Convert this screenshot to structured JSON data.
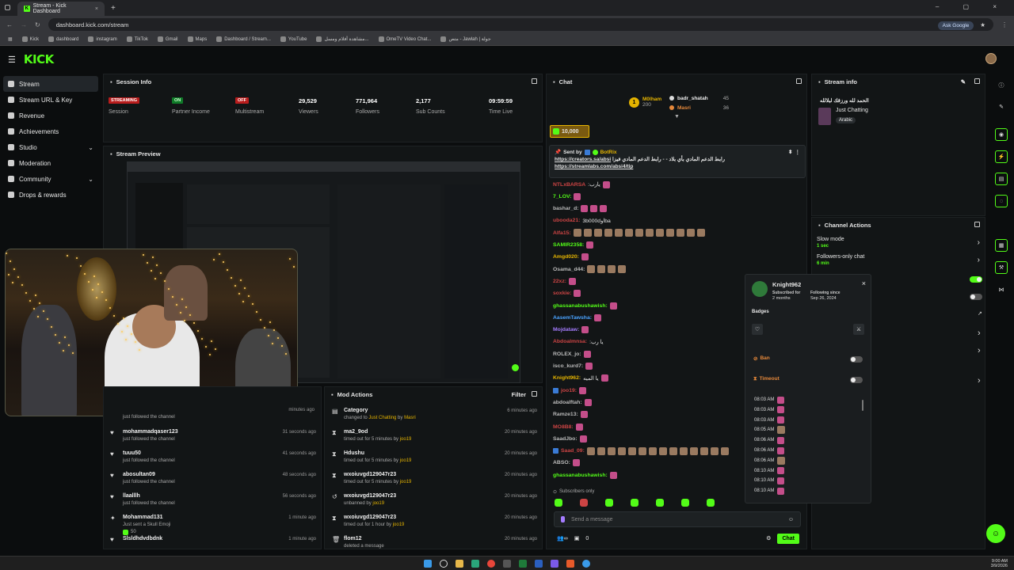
{
  "browser": {
    "tab_title": "Stream - Kick Dashboard",
    "url": "dashboard.kick.com/stream",
    "ask_google": "Ask Google",
    "bookmarks": [
      "Kick",
      "dashboard",
      "instagram",
      "TikTok",
      "Gmail",
      "Maps",
      "Dashboard / Stream...",
      "YouTube",
      "مشاهدة أفلام ومسل...",
      "OmeTV Video Chat...",
      "متص - Jawlah | جولة"
    ]
  },
  "brand": {
    "logo": "KICK",
    "accent": "#53fc18"
  },
  "sidebar": {
    "items": [
      {
        "label": "Stream",
        "icon": "stream-icon",
        "active": true
      },
      {
        "label": "Stream URL & Key",
        "icon": "key-icon"
      },
      {
        "label": "Revenue",
        "icon": "coin-icon"
      },
      {
        "label": "Achievements",
        "icon": "trophy-icon"
      },
      {
        "label": "Studio",
        "icon": "studio-icon",
        "expandable": true
      },
      {
        "label": "Moderation",
        "icon": "sword-icon"
      },
      {
        "label": "Community",
        "icon": "community-icon",
        "expandable": true
      },
      {
        "label": "Drops & rewards",
        "icon": "gift-icon"
      }
    ]
  },
  "session": {
    "title": "Session Info",
    "stats": [
      {
        "value": "STREAMING",
        "label": "Session",
        "kind": "badge-red"
      },
      {
        "value": "ON",
        "label": "Partner Income",
        "kind": "badge-green"
      },
      {
        "value": "OFF",
        "label": "Multistream",
        "kind": "badge-red"
      },
      {
        "value": "29,529",
        "label": "Viewers"
      },
      {
        "value": "771,964",
        "label": "Followers"
      },
      {
        "value": "2,177",
        "label": "Sub Counts"
      },
      {
        "value": "09:59:59",
        "label": "Time Live"
      }
    ]
  },
  "preview": {
    "title": "Stream Preview"
  },
  "followers": {
    "just_followed_text": "just followed the channel",
    "rows": [
      {
        "name": "mohammadqaser123",
        "sub": "just followed the channel",
        "time": "31 seconds ago"
      },
      {
        "name": "tuuu50",
        "sub": "just followed the channel",
        "time": "41 seconds ago"
      },
      {
        "name": "abosultan09",
        "sub": "just followed the channel",
        "time": "48 seconds ago"
      },
      {
        "name": "llaalllh",
        "sub": "just followed the channel",
        "time": "56 seconds ago"
      },
      {
        "name": "Mohammad131",
        "sub": "Just sent a Skull Emoji",
        "amount": "50",
        "time": "1 minute ago"
      },
      {
        "name": "Slsldhdvdbdnk",
        "sub": "",
        "time": "1 minute ago"
      }
    ],
    "top_time": "minutes ago"
  },
  "mod_actions": {
    "title": "Mod Actions",
    "filter": "Filter",
    "rows": [
      {
        "icon": "category-icon",
        "name": "Category",
        "sub_pre": "changed to ",
        "sub_hl": "Just Chatting",
        "sub_mid": " by ",
        "sub_by": "Masri",
        "time": "6 minutes ago"
      },
      {
        "icon": "hourglass-icon",
        "name": "ma2_9od",
        "sub_pre": "timed out for 5 minutes by ",
        "sub_by": "joo19",
        "time": "20 minutes ago"
      },
      {
        "icon": "hourglass-icon",
        "name": "Hdushu",
        "sub_pre": "timed out for 5 minutes by ",
        "sub_by": "joo19",
        "time": "20 minutes ago"
      },
      {
        "icon": "hourglass-icon",
        "name": "wxoiuvgd129047r23",
        "sub_pre": "timed out for 5 minutes by ",
        "sub_by": "joo19",
        "time": "20 minutes ago"
      },
      {
        "icon": "unban-icon",
        "name": "wxoiuvgd129047r23",
        "sub_pre": "unbanned by ",
        "sub_by": "joo19",
        "time": "20 minutes ago"
      },
      {
        "icon": "hourglass-icon",
        "name": "wxoiuvgd129047r23",
        "sub_pre": "timed out for 1 hour by ",
        "sub_by": "joo19",
        "time": "20 minutes ago"
      },
      {
        "icon": "trash-icon",
        "name": "flom12",
        "sub_pre": "deleted a message",
        "sub_by": "",
        "time": "20 minutes ago"
      }
    ]
  },
  "chat": {
    "title": "Chat",
    "top_gifter": {
      "rank": "1",
      "name": "M0lham",
      "count": "200"
    },
    "gifters": [
      {
        "name": "badr_shatah",
        "count": "45"
      },
      {
        "name": "Masri",
        "count": "36"
      }
    ],
    "kicks_amount": "10,000",
    "pinned": {
      "sent_by_label": "Sent by",
      "sender": "BotRix",
      "text_rtl": "رابط الدعم المادي بأي بلاد -",
      "link1": "https://creators.sa/absi",
      "text2": "- رابط الدعم المادي فيزا",
      "link2": "https://streamlabs.com/absi4/tip"
    },
    "messages": [
      {
        "user": "NTLxBARSA",
        "color": "#c44",
        "text": ":يارب"
      },
      {
        "user": "7_LOV:",
        "color": "#53fc18",
        "text": ""
      },
      {
        "user": "bashar_d:",
        "color": "#bbb",
        "text": ""
      },
      {
        "user": "ubooda21:",
        "color": "#c44",
        "text": "3b000dاوba"
      },
      {
        "user": "Alfa15:",
        "color": "#c44",
        "text": ""
      },
      {
        "user": "SAMIR2358:",
        "color": "#53fc18",
        "text": ""
      },
      {
        "user": "Amgd020:",
        "color": "#e5b400",
        "text": ""
      },
      {
        "user": "Osama_d44:",
        "color": "#bbb",
        "text": ""
      },
      {
        "user": "22xz:",
        "color": "#c44",
        "text": ""
      },
      {
        "user": "soxkie:",
        "color": "#c44",
        "text": ""
      },
      {
        "user": "ghassanabushawish:",
        "color": "#53fc18",
        "text": ""
      },
      {
        "user": "AasemTawsha:",
        "color": "#4aa3ff",
        "text": ""
      },
      {
        "user": "Mojdataw:",
        "color": "#a57cff",
        "text": ""
      },
      {
        "user": "Abdoalmnsa:",
        "color": "#c44",
        "text": ":يا رب"
      },
      {
        "user": "ROLEX_jo:",
        "color": "#bbb",
        "text": ""
      },
      {
        "user": "isco_kurd7:",
        "color": "#bbb",
        "text": ""
      },
      {
        "user": "Knight962:",
        "color": "#e5b400",
        "text": "يا الميه"
      },
      {
        "user": "joo19:",
        "color": "#c44",
        "text": ""
      },
      {
        "user": "abdoalftah:",
        "color": "#bbb",
        "text": ""
      },
      {
        "user": "Ramze13:",
        "color": "#bbb",
        "text": ""
      },
      {
        "user": "MO8B8:",
        "color": "#c44",
        "text": ""
      },
      {
        "user": "SaadJbo:",
        "color": "#bbb",
        "text": ""
      },
      {
        "user": "Saad_09:",
        "color": "#c44",
        "text": ""
      },
      {
        "user": "ABSO:",
        "color": "#bbb",
        "text": ""
      },
      {
        "user": "ghassanabushawish:",
        "color": "#53fc18",
        "text": ""
      }
    ],
    "subscribers_only": "Subscribers only",
    "input_placeholder": "Send a message",
    "send_button": "Chat",
    "points": "0"
  },
  "user_card": {
    "username": "Knight962",
    "subscribed_label": "Subscribed for",
    "subscribed_value": "2 months",
    "following_label": "Following since",
    "following_value": "Sep 26, 2024",
    "badges_label": "Badges",
    "ban_label": "Ban",
    "timeout_label": "Timeout",
    "log_times": [
      "08:03 AM",
      "08:03 AM",
      "08:03 AM",
      "08:05 AM",
      "08:06 AM",
      "08:06 AM",
      "08:06 AM",
      "08:10 AM",
      "08:10 AM",
      "08:10 AM"
    ]
  },
  "stream_info": {
    "title": "Stream info",
    "stream_title": "الحمد لله ورزقك لبلالله",
    "category": "Just Chatting",
    "language": "Arabic"
  },
  "channel_actions": {
    "title": "Channel Actions",
    "items": [
      {
        "label": "Slow mode",
        "sub": "1 sec"
      },
      {
        "label": "Followers-only chat",
        "sub": "6 min"
      }
    ]
  },
  "taskbar": {
    "time": "9:00 AM",
    "date": "3/9/2026"
  }
}
